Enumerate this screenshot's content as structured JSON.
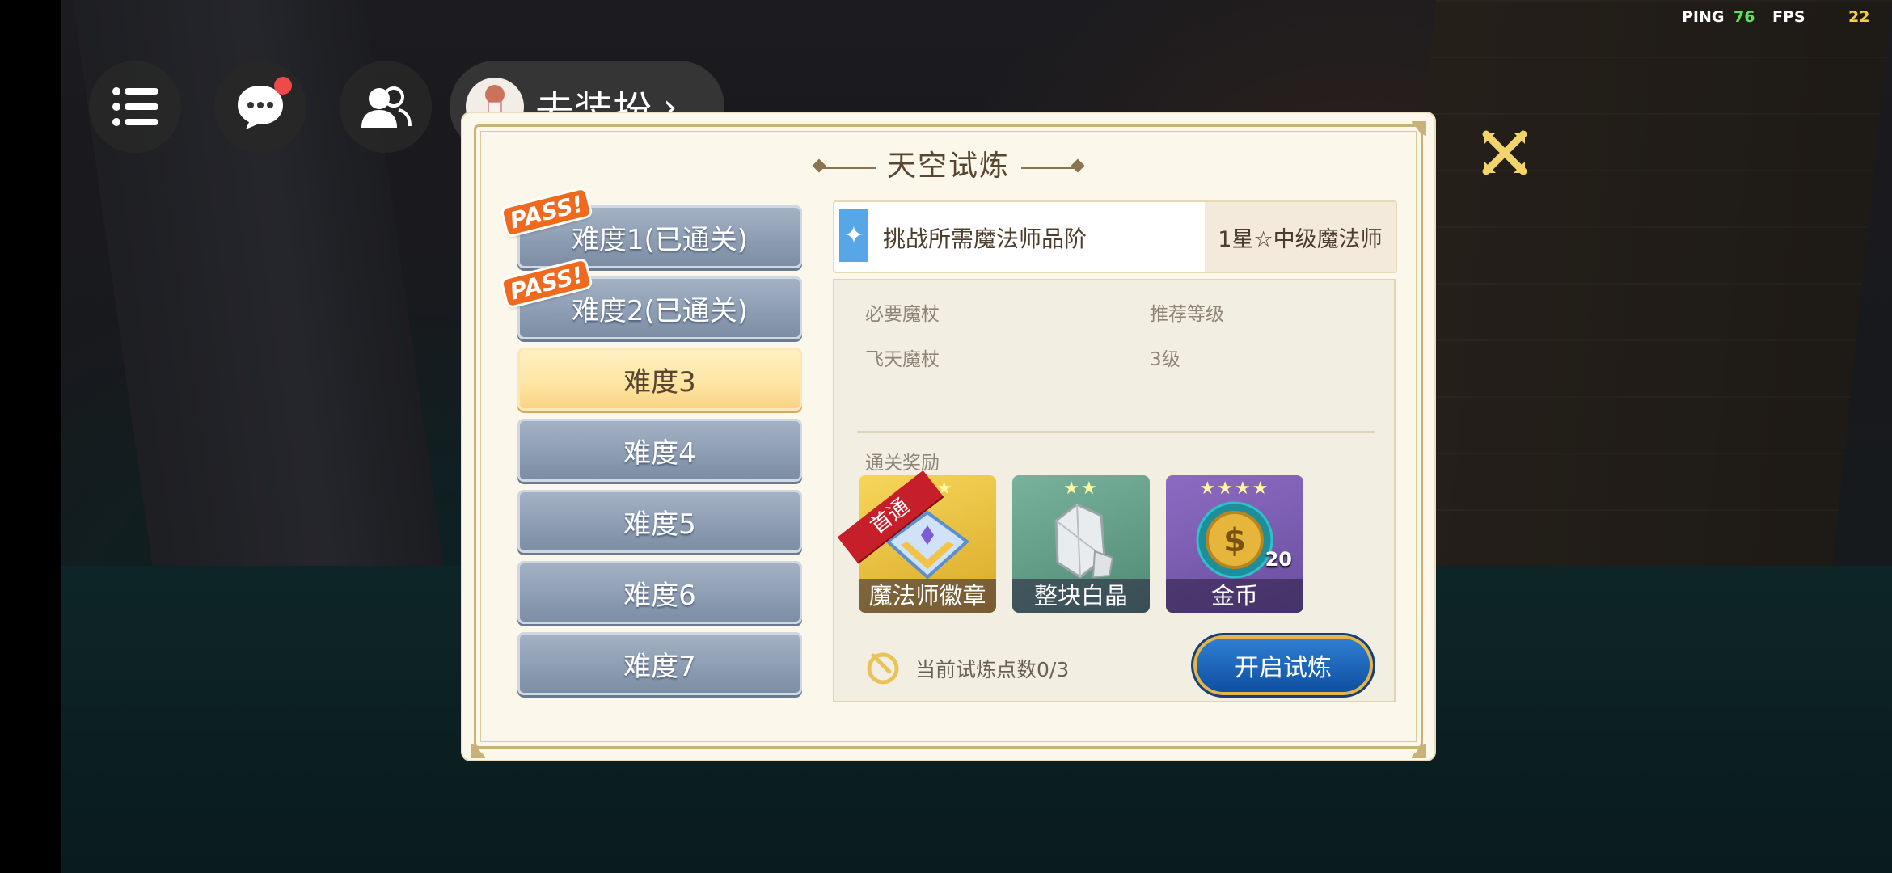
{
  "perf": {
    "ping_label": "PING",
    "ping_value": "76",
    "fps_label": "FPS",
    "fps_value": "22"
  },
  "hud": {
    "dress_label": "去装扮",
    "chat_has_notification": true
  },
  "panel": {
    "title": "天空试炼",
    "difficulties": [
      {
        "label": "难度1(已通关)",
        "passed": true
      },
      {
        "label": "难度2(已通关)",
        "passed": true
      },
      {
        "label": "难度3",
        "selected": true
      },
      {
        "label": "难度4"
      },
      {
        "label": "难度5"
      },
      {
        "label": "难度6"
      },
      {
        "label": "难度7"
      }
    ],
    "pass_badge": "PASS!",
    "requirement": {
      "label": "挑战所需魔法师品阶",
      "value": "1星☆中级魔法师"
    },
    "info": {
      "col1_header": "必要魔杖",
      "col2_header": "推荐等级",
      "col1_value": "飞天魔杖",
      "col2_value": "3级"
    },
    "rewards_title": "通关奖励",
    "rewards": [
      {
        "name": "魔法师徽章",
        "ribbon": "首通",
        "stars": 3,
        "color": "#e9c23a"
      },
      {
        "name": "整块白晶",
        "stars": 2,
        "color": "#5f9b86"
      },
      {
        "name": "金币",
        "stars": 4,
        "count": "20",
        "color": "#7b5bb0"
      }
    ],
    "points_text": "当前试炼点数0/3",
    "start_label": "开启试炼"
  },
  "colors": {
    "panel_bg": "#fbf7ea",
    "accent_gold": "#c9b27a",
    "button_blue": "#1b5fb1"
  }
}
